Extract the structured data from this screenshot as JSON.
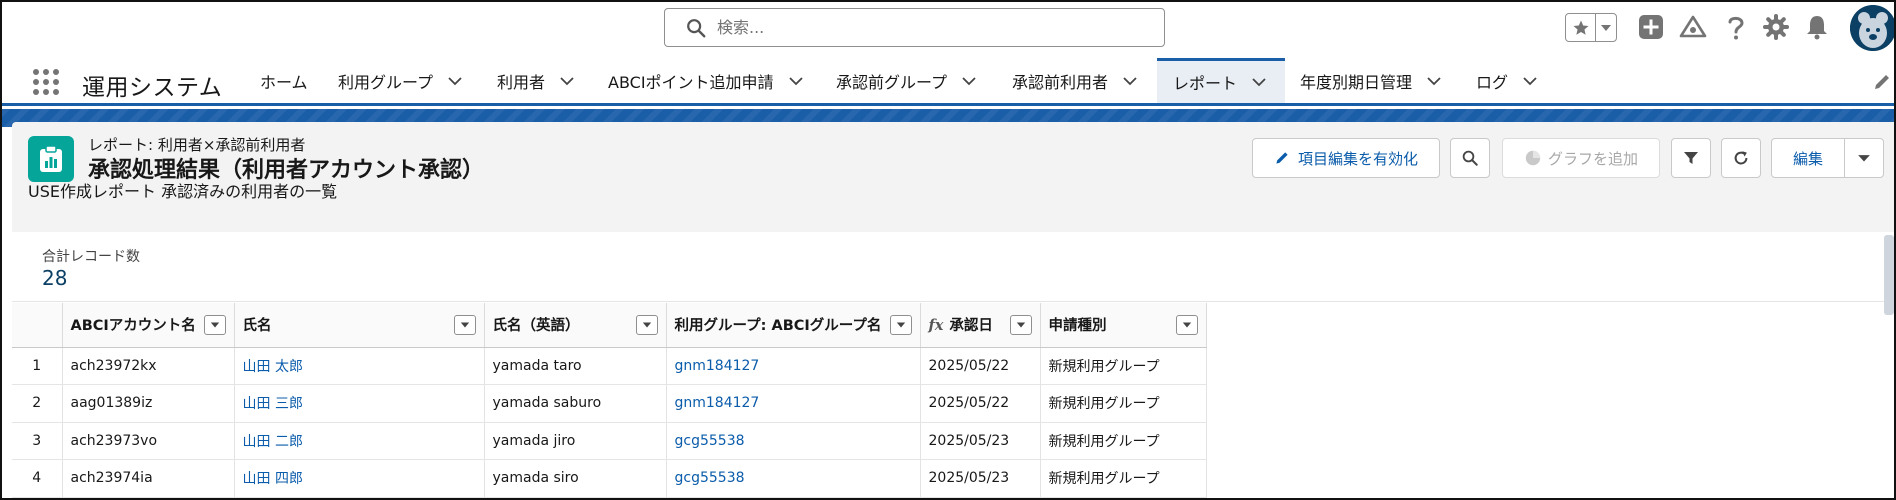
{
  "search": {
    "placeholder": "検索..."
  },
  "app": {
    "name": "運用システム"
  },
  "nav": {
    "items": [
      {
        "label": "ホーム",
        "has_menu": false
      },
      {
        "label": "利用グループ",
        "has_menu": true
      },
      {
        "label": "利用者",
        "has_menu": true
      },
      {
        "label": "ABCIポイント追加申請",
        "has_menu": true
      },
      {
        "label": "承認前グループ",
        "has_menu": true
      },
      {
        "label": "承認前利用者",
        "has_menu": true
      },
      {
        "label": "レポート",
        "has_menu": true,
        "active": true
      },
      {
        "label": "年度別期日管理",
        "has_menu": true
      },
      {
        "label": "ログ",
        "has_menu": true
      }
    ]
  },
  "report": {
    "eyebrow": "レポート: 利用者×承認前利用者",
    "title": "承認処理結果（利用者アカウント承認）",
    "description": "USE作成レポート 承認済みの利用者の一覧",
    "buttons": {
      "enable_field_edit": "項目編集を有効化",
      "add_chart": "グラフを追加",
      "edit": "編集"
    },
    "summary": {
      "label": "合計レコード数",
      "value": "28"
    }
  },
  "table": {
    "columns": [
      {
        "label": "ABCIアカウント名",
        "formula": false
      },
      {
        "label": "氏名",
        "formula": false
      },
      {
        "label": "氏名（英語）",
        "formula": false
      },
      {
        "label": "利用グループ: ABCIグループ名",
        "formula": false
      },
      {
        "label": "承認日",
        "formula": true
      },
      {
        "label": "申請種別",
        "formula": false
      }
    ],
    "formula_symbol": "fx",
    "rows": [
      {
        "num": "1",
        "account": "ach23972kx",
        "name": "山田 太郎",
        "name_en": "yamada taro",
        "group": "gnm184127",
        "date": "2025/05/22",
        "type": "新規利用グループ"
      },
      {
        "num": "2",
        "account": "aag01389iz",
        "name": "山田 三郎",
        "name_en": "yamada saburo",
        "group": "gnm184127",
        "date": "2025/05/22",
        "type": "新規利用グループ"
      },
      {
        "num": "3",
        "account": "ach23973vo",
        "name": "山田 二郎",
        "name_en": "yamada jiro",
        "group": "gcg55538",
        "date": "2025/05/23",
        "type": "新規利用グループ"
      },
      {
        "num": "4",
        "account": "ach23974ia",
        "name": "山田 四郎",
        "name_en": "yamada siro",
        "group": "gcg55538",
        "date": "2025/05/23",
        "type": "新規利用グループ"
      }
    ]
  },
  "colors": {
    "brand_blue": "#1b5ea8",
    "report_icon_teal": "#06a59a",
    "link_blue": "#0b5cab"
  }
}
